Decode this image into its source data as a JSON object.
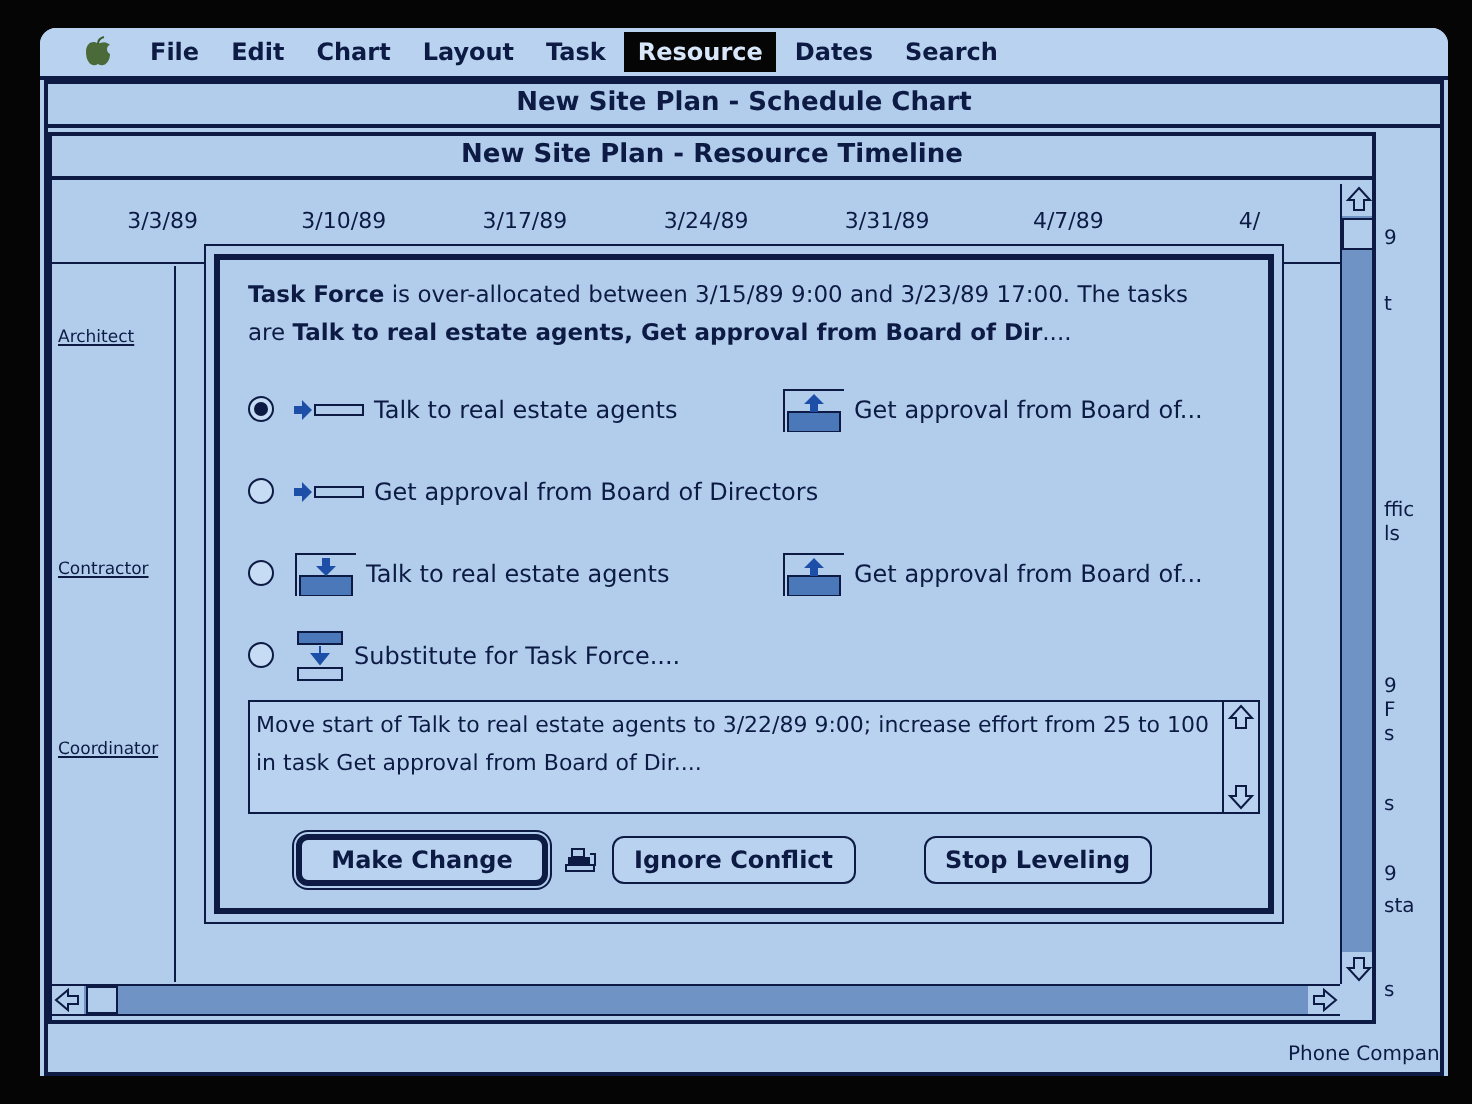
{
  "menu_bar": {
    "items": [
      {
        "label": "File",
        "selected": false
      },
      {
        "label": "Edit",
        "selected": false
      },
      {
        "label": "Chart",
        "selected": false
      },
      {
        "label": "Layout",
        "selected": false
      },
      {
        "label": "Task",
        "selected": false
      },
      {
        "label": "Resource",
        "selected": true
      },
      {
        "label": "Dates",
        "selected": false
      },
      {
        "label": "Search",
        "selected": false
      }
    ]
  },
  "schedule_window": {
    "title": "New Site Plan - Schedule Chart",
    "visible_fragments": [
      "9",
      "t",
      "ffic",
      "ls",
      "9",
      "F",
      "s",
      "s",
      "9",
      "sta",
      "s"
    ],
    "bottom_label": "Phone Compan"
  },
  "timeline_window": {
    "title": "New Site Plan - Resource Timeline",
    "dates": [
      "3/3/89",
      "3/10/89",
      "3/17/89",
      "3/24/89",
      "3/31/89",
      "4/7/89",
      "4/"
    ],
    "resources": [
      "Architect",
      "Contractor",
      "Coordinator"
    ]
  },
  "dialog": {
    "message": "**Task Force** is over-allocated between 3/15/89  9:00 and 3/23/89  17:00.  The tasks are **Talk to real estate agents, Get approval from Board of Dir**....",
    "options": [
      {
        "selected": true,
        "parts": [
          {
            "kind": "shift",
            "label": "Talk to real estate agents"
          },
          {
            "kind": "effort_up",
            "label": "Get approval from Board of..."
          }
        ]
      },
      {
        "selected": false,
        "parts": [
          {
            "kind": "shift",
            "label": "Get approval from Board of Directors"
          }
        ]
      },
      {
        "selected": false,
        "parts": [
          {
            "kind": "effort_down",
            "label": "Talk to real estate agents"
          },
          {
            "kind": "effort_up",
            "label": "Get approval from Board of..."
          }
        ]
      },
      {
        "selected": false,
        "parts": [
          {
            "kind": "substitute",
            "label": "Substitute for Task Force...."
          }
        ]
      }
    ],
    "description": "Move start of Talk to real estate agents to 3/22/89  9:00; increase effort from 25 to 100 in task Get approval from Board of Dir....",
    "buttons": [
      {
        "label": "Make Change",
        "default": true
      },
      {
        "label": "Ignore Conflict",
        "default": false
      },
      {
        "label": "Stop Leveling",
        "default": false
      }
    ]
  }
}
